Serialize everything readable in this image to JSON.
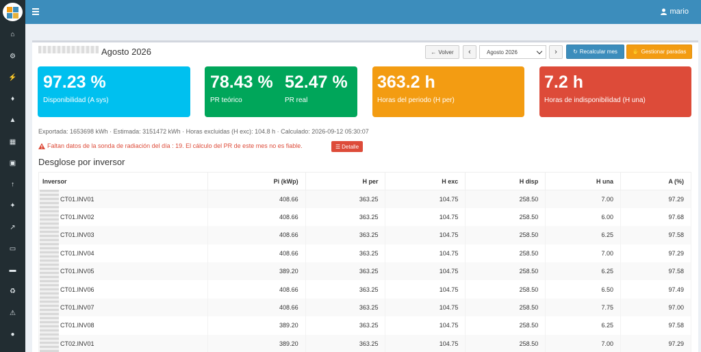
{
  "topbar": {
    "user_name": "mario"
  },
  "sidebar": {
    "items": [
      "home-icon",
      "gear-icon",
      "plug-icon",
      "bell-icon",
      "area-chart-icon",
      "map-icon",
      "monitor-icon",
      "upload-icon",
      "wrench-icon",
      "line-chart-icon",
      "battery-icon",
      "credit-card-icon",
      "recycle-icon",
      "warning-icon",
      "android-icon"
    ]
  },
  "header": {
    "title": "Agosto 2026",
    "back_label": "Volver",
    "month_select_value": "Agosto 2026",
    "recalc_label": "Recalcular mes",
    "stops_label": "Gestionar paradas"
  },
  "cards": [
    {
      "value": "97.23 %",
      "label": "Disponibilidad (A sys)",
      "color": "#00c0ef"
    },
    {
      "value": "78.43 %",
      "label": "PR teórico",
      "value2": "52.47 %",
      "label2": "PR real",
      "color": "#00a65a"
    },
    {
      "value": "363.2 h",
      "label": "Horas del periodo (H per)",
      "color": "#f39c12"
    },
    {
      "value": "7.2 h",
      "label": "Horas de indisponibilidad (H una)",
      "color": "#dd4b39"
    }
  ],
  "info_line": "Exportada: 1653698 kWh · Estimada: 3151472 kWh · Horas excluidas (H exc): 104.8 h · Calculado: 2026-09-12 05:30:07",
  "warning": {
    "text": "Faltan datos de la sonda de radiación del día : 19. El cálculo del PR de este mes no es fiable.",
    "detail_label": "Detalle"
  },
  "section_title": "Desglose por inversor",
  "table": {
    "headers": [
      "Inversor",
      "Pi (kWp)",
      "H per",
      "H exc",
      "H disp",
      "H una",
      "A (%)"
    ],
    "rows": [
      [
        "CT01.INV01",
        "408.66",
        "363.25",
        "104.75",
        "258.50",
        "7.00",
        "97.29"
      ],
      [
        "CT01.INV02",
        "408.66",
        "363.25",
        "104.75",
        "258.50",
        "6.00",
        "97.68"
      ],
      [
        "CT01.INV03",
        "408.66",
        "363.25",
        "104.75",
        "258.50",
        "6.25",
        "97.58"
      ],
      [
        "CT01.INV04",
        "408.66",
        "363.25",
        "104.75",
        "258.50",
        "7.00",
        "97.29"
      ],
      [
        "CT01.INV05",
        "389.20",
        "363.25",
        "104.75",
        "258.50",
        "6.25",
        "97.58"
      ],
      [
        "CT01.INV06",
        "408.66",
        "363.25",
        "104.75",
        "258.50",
        "6.50",
        "97.49"
      ],
      [
        "CT01.INV07",
        "408.66",
        "363.25",
        "104.75",
        "258.50",
        "7.75",
        "97.00"
      ],
      [
        "CT01.INV08",
        "389.20",
        "363.25",
        "104.75",
        "258.50",
        "6.25",
        "97.58"
      ],
      [
        "CT02.INV01",
        "389.20",
        "363.25",
        "104.75",
        "258.50",
        "7.00",
        "97.29"
      ]
    ]
  }
}
